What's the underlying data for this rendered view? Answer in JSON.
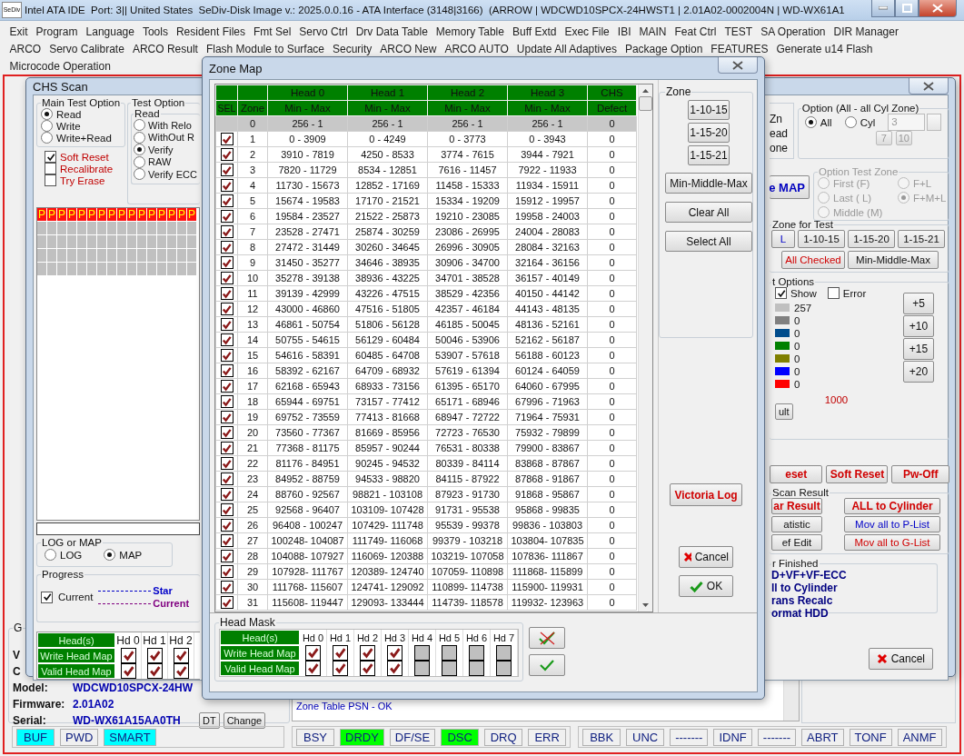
{
  "title_bar": {
    "icon_text": "SeDiv",
    "title": "Intel ATA IDE  Port: 3|| United States  SeDiv-Disk Image v.: 2025.0.0.16 - ATA Interface (3148|3166)  (ARROW | WDCWD10SPCX-24HWST1 | 2.01A02-0002004N | WD-WX61A1"
  },
  "menu_rows": [
    [
      "Exit",
      "Program",
      "Language",
      "Tools",
      "Resident Files",
      "Fmt Sel",
      "Servo Ctrl",
      "Drv Data Table",
      "Memory Table",
      "Buff Extd",
      "Exec File",
      "IBI",
      "MAIN",
      "Feat Ctrl",
      "TEST",
      "SA Operation",
      "DIR Manager"
    ],
    [
      "ARCO",
      "Servo Calibrate",
      "ARCO Result",
      "Flash Module to Surface",
      "Security",
      "ARCO New",
      "ARCO AUTO",
      "Update All Adaptives",
      "Package Option",
      "FEATURES",
      "Generate u14 Flash"
    ],
    [
      "Microcode Operation"
    ]
  ],
  "chs_scan": {
    "title": "CHS Scan",
    "main_test_option": {
      "label": "Main Test Option",
      "options": [
        {
          "label": "Read",
          "selected": true
        },
        {
          "label": "Write",
          "selected": false
        },
        {
          "label": "Write+Read",
          "selected": false
        }
      ]
    },
    "flags": [
      {
        "label": "Soft Reset",
        "checked": true
      },
      {
        "label": "Recalibrate",
        "checked": false
      },
      {
        "label": "Try Erase",
        "checked": false
      }
    ],
    "test_option": {
      "label": "Test Option",
      "group": "Read",
      "options": [
        {
          "label": "With Relo",
          "selected": false
        },
        {
          "label": "WithOut R",
          "selected": false
        },
        {
          "label": "Verify",
          "selected": true
        },
        {
          "label": "RAW",
          "selected": false
        },
        {
          "label": "Verify ECC",
          "selected": false
        }
      ]
    },
    "map_cells": [
      "P",
      "P",
      "P",
      "P",
      "P",
      "P",
      "P",
      "P",
      "P",
      "P",
      "P",
      "P",
      "P",
      "P",
      "P",
      "P"
    ],
    "progress_bar": {
      "level": 0
    },
    "log_or_map": {
      "label": "LOG or MAP",
      "options": [
        {
          "label": "LOG",
          "selected": false
        },
        {
          "label": "MAP",
          "selected": true
        }
      ]
    },
    "progress": {
      "label": "Progress",
      "current": {
        "label": "Current",
        "checked": true
      },
      "legend": [
        {
          "label": "Star",
          "color": "#0000c8"
        },
        {
          "label": "Current",
          "color": "#800080"
        }
      ]
    },
    "head_table": {
      "header": "Head(s)",
      "row_labels": [
        "Write Head Map",
        "Valid Head Map"
      ],
      "heads": [
        {
          "label": "Hd 0",
          "write": true,
          "valid": true
        },
        {
          "label": "Hd 1",
          "write": true,
          "valid": true
        },
        {
          "label": "Hd 2",
          "write": true,
          "valid": true
        }
      ]
    },
    "right": {
      "zn_texts": [
        "Zn",
        "ead",
        "one"
      ],
      "option_all": {
        "label": "Option (All - all Cyl Zone)",
        "options": [
          {
            "label": "All",
            "selected": true
          },
          {
            "label": "Cyl",
            "selected": false
          }
        ],
        "cyl_value": "3",
        "buttons": [
          "7",
          "10"
        ]
      },
      "map_button": "e MAP",
      "test_zone": {
        "label": "Option Test Zone",
        "disabled": true,
        "options": [
          {
            "label": "First (F)",
            "selected": false
          },
          {
            "label": "F+L",
            "selected": false
          },
          {
            "label": "Last ( L)",
            "selected": false
          },
          {
            "label": "F+M+L",
            "selected": true
          },
          {
            "label": "Middle (M)",
            "selected": false
          }
        ]
      },
      "zone_for_test": {
        "label": "Zone for Test",
        "buttons": [
          {
            "label": "L",
            "kind": "blue"
          },
          {
            "label": "1-10-15",
            "kind": "normal"
          },
          {
            "label": "1-15-20",
            "kind": "normal"
          },
          {
            "label": "1-15-21",
            "kind": "normal"
          },
          {
            "label": "All Checked",
            "kind": "red"
          },
          {
            "label": "Min-Middle-Max",
            "kind": "normal"
          }
        ]
      },
      "options": {
        "label": "t Options",
        "show": {
          "label": "Show",
          "checked": true
        },
        "error": {
          "label": "Error",
          "checked": false
        },
        "legend": [
          {
            "color": "#c0c0c0",
            "count": "257"
          },
          {
            "color": "#808080",
            "count": "0"
          },
          {
            "color": "#004c8c",
            "count": "0"
          },
          {
            "color": "#008000",
            "count": "0"
          },
          {
            "color": "#808000",
            "count": "0"
          },
          {
            "color": "#0000ff",
            "count": "0"
          },
          {
            "color": "#ff0000",
            "count": "0"
          }
        ],
        "result_button": "ult",
        "limit": "1000",
        "step_buttons": [
          "+5",
          "+10",
          "+15",
          "+20"
        ]
      },
      "reset_buttons": [
        "eset",
        "Soft Reset",
        "Pw-Off"
      ],
      "scan_result": {
        "label": "Scan Result",
        "buttons": [
          {
            "label": "ar Result",
            "kind": "red-bold"
          },
          {
            "label": "ALL to Cylinder",
            "kind": "red-bold"
          },
          {
            "label": "atistic",
            "kind": "normal"
          },
          {
            "label": "Mov all to P-List",
            "kind": "blue"
          },
          {
            "label": "ef Edit",
            "kind": "normal"
          },
          {
            "label": "Mov all to G-List",
            "kind": "red"
          }
        ]
      },
      "finished": {
        "label": "r Finished",
        "items": [
          "D+VF+VF-ECC",
          "ll to Cylinder",
          "rans Recalc",
          "ormat HDD"
        ]
      }
    }
  },
  "zone_map": {
    "title": "Zone Map",
    "columns": [
      {
        "subheading": "SEL"
      },
      {
        "subheading": "Zone"
      },
      {
        "heading": "Head 0",
        "subheading": "Min - Max"
      },
      {
        "heading": "Head 1",
        "subheading": "Min - Max"
      },
      {
        "heading": "Head 2",
        "subheading": "Min - Max"
      },
      {
        "heading": "Head 3",
        "subheading": "Min - Max"
      },
      {
        "heading": "CHS",
        "subheading": "Defect"
      }
    ],
    "rows": [
      {
        "kind": "reference",
        "zone": "0",
        "heads": [
          "256 - 1",
          "256 - 1",
          "256 - 1",
          "256 - 1"
        ],
        "defect": "0"
      },
      {
        "kind": "zone",
        "checked": true,
        "zone": "1",
        "heads": [
          "0 - 3909",
          "0 - 4249",
          "0 - 3773",
          "0 - 3943"
        ],
        "defect": "0"
      },
      {
        "kind": "zone",
        "checked": true,
        "zone": "2",
        "heads": [
          "3910 - 7819",
          "4250 - 8533",
          "3774 - 7615",
          "3944 - 7921"
        ],
        "defect": "0"
      },
      {
        "kind": "zone",
        "checked": true,
        "zone": "3",
        "heads": [
          "7820 - 11729",
          "8534 - 12851",
          "7616 - 11457",
          "7922 - 11933"
        ],
        "defect": "0"
      },
      {
        "kind": "zone",
        "checked": true,
        "zone": "4",
        "heads": [
          "11730 - 15673",
          "12852 - 17169",
          "11458 - 15333",
          "11934 - 15911"
        ],
        "defect": "0"
      },
      {
        "kind": "zone",
        "checked": true,
        "zone": "5",
        "heads": [
          "15674 - 19583",
          "17170 - 21521",
          "15334 - 19209",
          "15912 - 19957"
        ],
        "defect": "0"
      },
      {
        "kind": "zone",
        "checked": true,
        "zone": "6",
        "heads": [
          "19584 - 23527",
          "21522 - 25873",
          "19210 - 23085",
          "19958 - 24003"
        ],
        "defect": "0"
      },
      {
        "kind": "zone",
        "checked": true,
        "zone": "7",
        "heads": [
          "23528 - 27471",
          "25874 - 30259",
          "23086 - 26995",
          "24004 - 28083"
        ],
        "defect": "0"
      },
      {
        "kind": "zone",
        "checked": true,
        "zone": "8",
        "heads": [
          "27472 - 31449",
          "30260 - 34645",
          "26996 - 30905",
          "28084 - 32163"
        ],
        "defect": "0"
      },
      {
        "kind": "zone",
        "checked": true,
        "zone": "9",
        "heads": [
          "31450 - 35277",
          "34646 - 38935",
          "30906 - 34700",
          "32164 - 36156"
        ],
        "defect": "0"
      },
      {
        "kind": "zone",
        "checked": true,
        "zone": "10",
        "heads": [
          "35278 - 39138",
          "38936 - 43225",
          "34701 - 38528",
          "36157 - 40149"
        ],
        "defect": "0"
      },
      {
        "kind": "zone",
        "checked": true,
        "zone": "11",
        "heads": [
          "39139 - 42999",
          "43226 - 47515",
          "38529 - 42356",
          "40150 - 44142"
        ],
        "defect": "0"
      },
      {
        "kind": "zone",
        "checked": true,
        "zone": "12",
        "heads": [
          "43000 - 46860",
          "47516 - 51805",
          "42357 - 46184",
          "44143 - 48135"
        ],
        "defect": "0"
      },
      {
        "kind": "zone",
        "checked": true,
        "zone": "13",
        "heads": [
          "46861 - 50754",
          "51806 - 56128",
          "46185 - 50045",
          "48136 - 52161"
        ],
        "defect": "0"
      },
      {
        "kind": "zone",
        "checked": true,
        "zone": "14",
        "heads": [
          "50755 - 54615",
          "56129 - 60484",
          "50046 - 53906",
          "52162 - 56187"
        ],
        "defect": "0"
      },
      {
        "kind": "zone",
        "checked": true,
        "zone": "15",
        "heads": [
          "54616 - 58391",
          "60485 - 64708",
          "53907 - 57618",
          "56188 - 60123"
        ],
        "defect": "0"
      },
      {
        "kind": "zone",
        "checked": true,
        "zone": "16",
        "heads": [
          "58392 - 62167",
          "64709 - 68932",
          "57619 - 61394",
          "60124 - 64059"
        ],
        "defect": "0"
      },
      {
        "kind": "zone",
        "checked": true,
        "zone": "17",
        "heads": [
          "62168 - 65943",
          "68933 - 73156",
          "61395 - 65170",
          "64060 - 67995"
        ],
        "defect": "0"
      },
      {
        "kind": "zone",
        "checked": true,
        "zone": "18",
        "heads": [
          "65944 - 69751",
          "73157 - 77412",
          "65171 - 68946",
          "67996 - 71963"
        ],
        "defect": "0"
      },
      {
        "kind": "zone",
        "checked": true,
        "zone": "19",
        "heads": [
          "69752 - 73559",
          "77413 - 81668",
          "68947 - 72722",
          "71964 - 75931"
        ],
        "defect": "0"
      },
      {
        "kind": "zone",
        "checked": true,
        "zone": "20",
        "heads": [
          "73560 - 77367",
          "81669 - 85956",
          "72723 - 76530",
          "75932 - 79899"
        ],
        "defect": "0"
      },
      {
        "kind": "zone",
        "checked": true,
        "zone": "21",
        "heads": [
          "77368 - 81175",
          "85957 - 90244",
          "76531 - 80338",
          "79900 - 83867"
        ],
        "defect": "0"
      },
      {
        "kind": "zone",
        "checked": true,
        "zone": "22",
        "heads": [
          "81176 - 84951",
          "90245 - 94532",
          "80339 - 84114",
          "83868 - 87867"
        ],
        "defect": "0"
      },
      {
        "kind": "zone",
        "checked": true,
        "zone": "23",
        "heads": [
          "84952 - 88759",
          "94533 - 98820",
          "84115 - 87922",
          "87868 - 91867"
        ],
        "defect": "0"
      },
      {
        "kind": "zone",
        "checked": true,
        "zone": "24",
        "heads": [
          "88760 - 92567",
          "98821 - 103108",
          "87923 - 91730",
          "91868 - 95867"
        ],
        "defect": "0"
      },
      {
        "kind": "zone",
        "checked": true,
        "zone": "25",
        "heads": [
          "92568 - 96407",
          "103109- 107428",
          "91731 - 95538",
          "95868 - 99835"
        ],
        "defect": "0"
      },
      {
        "kind": "zone",
        "checked": true,
        "zone": "26",
        "heads": [
          "96408 - 100247",
          "107429- 111748",
          "95539 - 99378",
          "99836 - 103803"
        ],
        "defect": "0"
      },
      {
        "kind": "zone",
        "checked": true,
        "zone": "27",
        "heads": [
          "100248- 104087",
          "111749- 116068",
          "99379 - 103218",
          "103804- 107835"
        ],
        "defect": "0"
      },
      {
        "kind": "zone",
        "checked": true,
        "zone": "28",
        "heads": [
          "104088- 107927",
          "116069- 120388",
          "103219- 107058",
          "107836- 111867"
        ],
        "defect": "0"
      },
      {
        "kind": "zone",
        "checked": true,
        "zone": "29",
        "heads": [
          "107928- 111767",
          "120389- 124740",
          "107059- 110898",
          "111868- 115899"
        ],
        "defect": "0"
      },
      {
        "kind": "zone",
        "checked": true,
        "zone": "30",
        "heads": [
          "111768- 115607",
          "124741- 129092",
          "110899- 114738",
          "115900- 119931"
        ],
        "defect": "0"
      },
      {
        "kind": "zone",
        "checked": true,
        "zone": "31",
        "heads": [
          "115608- 119447",
          "129093- 133444",
          "114739- 118578",
          "119932- 123963"
        ],
        "defect": "0"
      }
    ],
    "zone_group": {
      "label": "Zone",
      "presets": [
        "1-10-15",
        "1-15-20",
        "1-15-21"
      ],
      "buttons": [
        "Min-Middle-Max",
        "Clear All",
        "Select All"
      ]
    },
    "victoria_log": "Victoria Log",
    "cancel": "Cancel",
    "ok": "OK",
    "head_mask": {
      "label": "Head Mask",
      "header": "Head(s)",
      "row_labels": [
        "Write Head Map",
        "Valid Head Map"
      ],
      "heads": [
        {
          "label": "Hd 0",
          "enabled": true,
          "write": true,
          "valid": true
        },
        {
          "label": "Hd 1",
          "enabled": true,
          "write": true,
          "valid": true
        },
        {
          "label": "Hd 2",
          "enabled": true,
          "write": true,
          "valid": true
        },
        {
          "label": "Hd 3",
          "enabled": true,
          "write": true,
          "valid": true
        },
        {
          "label": "Hd 4",
          "enabled": false
        },
        {
          "label": "Hd 5",
          "enabled": false
        },
        {
          "label": "Hd 6",
          "enabled": false
        },
        {
          "label": "Hd 7",
          "enabled": false
        }
      ]
    }
  },
  "device_info": {
    "group_label": "G",
    "row_labels": [
      "V",
      "C"
    ],
    "model": {
      "label": "Model:",
      "value": "WDCWD10SPCX-24HW"
    },
    "firmware": {
      "label": "Firmware:",
      "value": "2.01A02"
    },
    "serial": {
      "label": "Serial:",
      "value": "WD-WX61A15AA0TH"
    },
    "buttons": [
      "DT",
      "Change"
    ],
    "log": [
      "Zone Table PSN - OK"
    ],
    "cancel": "Cancel"
  },
  "status_bar": [
    {
      "color": "#00ffff",
      "items": [
        {
          "label": "BUF",
          "on": true
        },
        {
          "label": "PWD",
          "on": false
        },
        {
          "label": "SMART",
          "on": true
        }
      ]
    },
    {
      "color": "#00ff00",
      "items": [
        {
          "label": "BSY",
          "on": false
        },
        {
          "label": "DRDY",
          "on": true
        },
        {
          "label": "DF/SE",
          "on": false
        },
        {
          "label": "DSC",
          "on": true
        },
        {
          "label": "DRQ",
          "on": false
        },
        {
          "label": "ERR",
          "on": false
        }
      ]
    },
    {
      "items": [
        {
          "label": "BBK",
          "on": false
        },
        {
          "label": "UNC",
          "on": false
        },
        {
          "label": "-------",
          "on": false
        },
        {
          "label": "IDNF",
          "on": false
        },
        {
          "label": "-------",
          "on": false
        },
        {
          "label": "ABRT",
          "on": false
        },
        {
          "label": "TONF",
          "on": false
        },
        {
          "label": "ANMF",
          "on": false
        }
      ]
    }
  ]
}
